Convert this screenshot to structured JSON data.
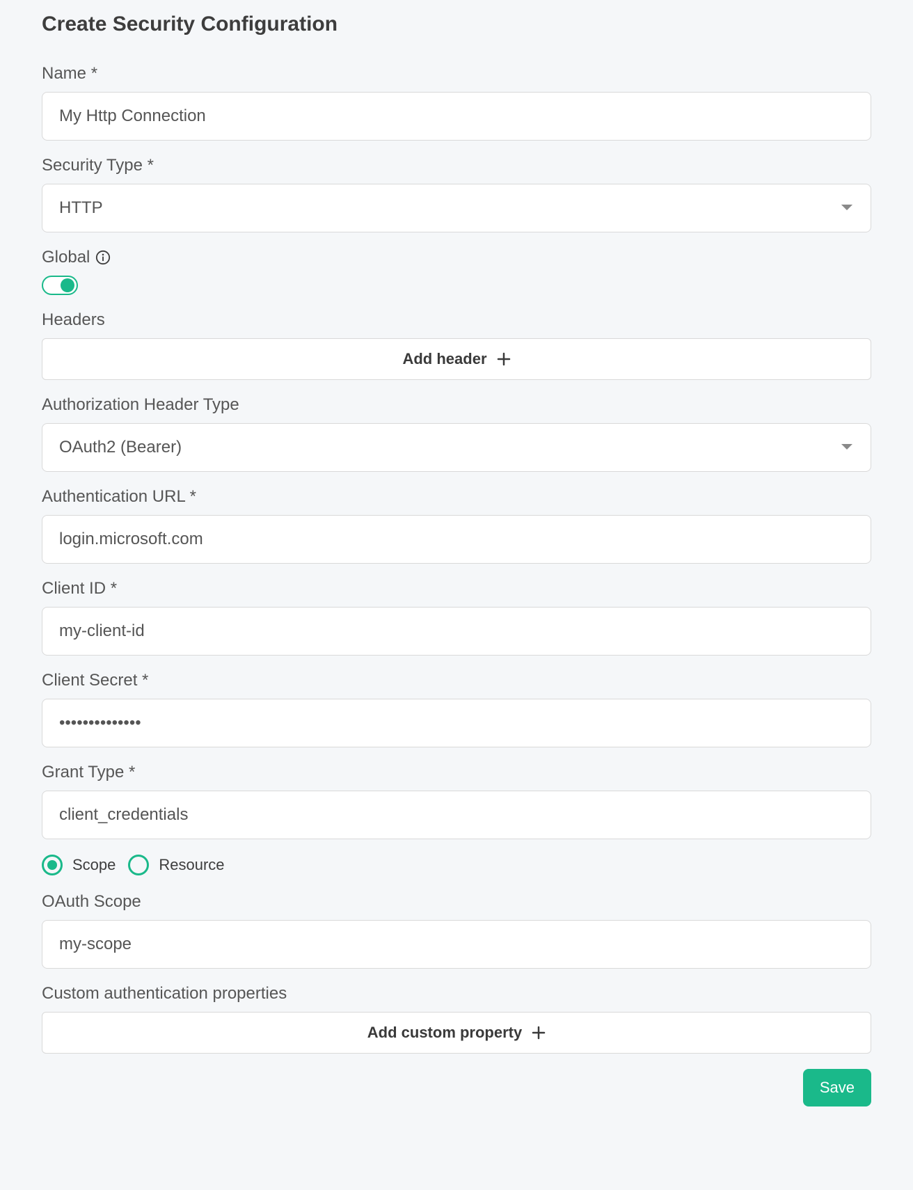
{
  "page_title": "Create Security Configuration",
  "fields": {
    "name": {
      "label": "Name *",
      "value": "My Http Connection"
    },
    "security_type": {
      "label": "Security Type *",
      "value": "HTTP"
    },
    "global": {
      "label": "Global",
      "on": true
    },
    "headers": {
      "label": "Headers",
      "add_button": "Add header"
    },
    "auth_header_type": {
      "label": "Authorization Header Type",
      "value": "OAuth2 (Bearer)"
    },
    "auth_url": {
      "label": "Authentication URL *",
      "value": "login.microsoft.com"
    },
    "client_id": {
      "label": "Client ID *",
      "value": "my-client-id"
    },
    "client_secret": {
      "label": "Client Secret *",
      "value": "••••••••••••••"
    },
    "grant_type": {
      "label": "Grant Type *",
      "value": "client_credentials"
    },
    "scope_resource": {
      "options": [
        {
          "label": "Scope",
          "selected": true
        },
        {
          "label": "Resource",
          "selected": false
        }
      ]
    },
    "oauth_scope": {
      "label": "OAuth Scope",
      "value": "my-scope"
    },
    "custom_auth_props": {
      "label": "Custom authentication properties",
      "add_button": "Add custom property"
    }
  },
  "buttons": {
    "save": "Save"
  }
}
